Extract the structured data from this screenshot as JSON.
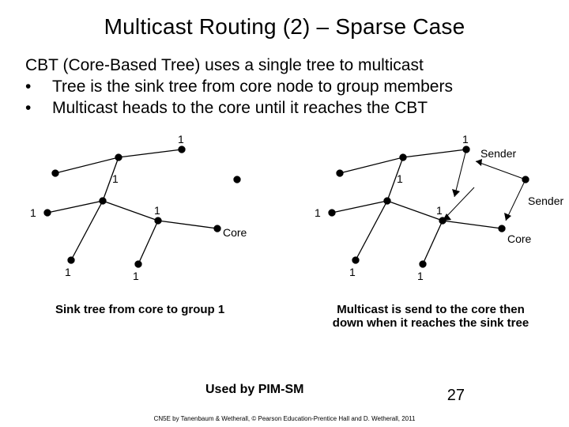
{
  "title": "Multicast Routing (2) – Sparse Case",
  "intro": "CBT (Core-Based Tree) uses a single tree to multicast",
  "bullets": {
    "mark": "•",
    "items": [
      "Tree is the sink tree from core node to group members",
      "Multicast heads to the core until it reaches the CBT"
    ]
  },
  "diagram": {
    "group_labels": {
      "one": "1",
      "core": "Core",
      "sender": "Sender"
    }
  },
  "captions": {
    "left": "Sink tree from core to group 1",
    "right_line1": "Multicast is send to the core then",
    "right_line2": "down when it reaches the sink tree"
  },
  "used_by": "Used by PIM-SM",
  "page_number": "27",
  "footer": "CN5E by Tanenbaum & Wetherall, © Pearson Education-Prentice Hall and D. Wetherall, 2011"
}
